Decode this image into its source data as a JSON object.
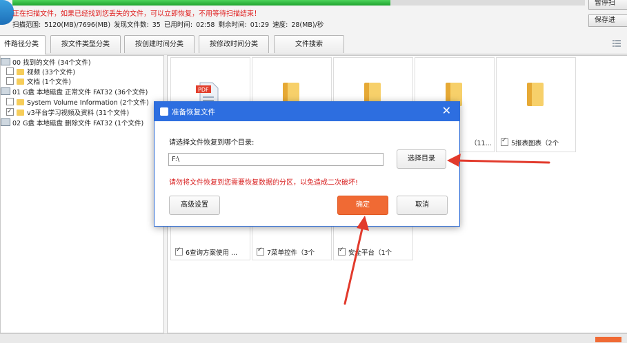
{
  "app": {
    "scan_warning": "正在扫描文件，如果已经找到您丢失的文件，可以立即恢复，不用等待扫描结束！",
    "stats": "扫描范围: 5120(MB)/7696(MB)   发现文件数: 35   已用时间: 02:58   剩余时间: 01:29   速度: 28(MB)/秒",
    "progress": 0.66,
    "buttons": {
      "pause": "暂停扫",
      "save": "保存进"
    }
  },
  "tabs": [
    {
      "label": "件路径分类",
      "active": true
    },
    {
      "label": "按文件类型分类",
      "active": false
    },
    {
      "label": "按创建时间分类",
      "active": false
    },
    {
      "label": "按修改时间分类",
      "active": false
    },
    {
      "label": "文件搜索",
      "active": false
    }
  ],
  "tree": [
    {
      "label": "00 找到的文件 (34个文件)"
    },
    {
      "label": "视频    (33个文件)"
    },
    {
      "label": "文档    (1个文件)"
    },
    {
      "label": "01 G盘 本地磁盘 正常文件 FAT32  (36个文件)"
    },
    {
      "label": "System Volume Information     (2个文件)"
    },
    {
      "label": "v3平台学习视频及资料     (31个文件)"
    },
    {
      "label": "02 G盘 本地磁盘 删除文件 FAT32  (1个文件)"
    }
  ],
  "grid": {
    "pdf_badge": "PDF",
    "cards_top": [
      {
        "label": ""
      },
      {
        "label": ""
      },
      {
        "label": ""
      },
      {
        "label": "（11..."
      },
      {
        "label": "5报表图表（2个"
      }
    ],
    "cards_bottom": [
      {
        "label": "6查询方案使用 ..."
      },
      {
        "label": "7菜单控件（3个"
      },
      {
        "label": "安全平台（1个"
      }
    ]
  },
  "dialog": {
    "title": "准备恢复文件",
    "close": "✕",
    "prompt": "请选择文件恢复到哪个目录:",
    "path_value": "F:\\",
    "choose_button": "选择目录",
    "warning": "请勿将文件恢复到您需要恢复数据的分区，以免造成二次破坏!",
    "advanced_button": "高级设置",
    "confirm_button": "确定",
    "cancel_button": "取消"
  },
  "colors": {
    "accent_blue": "#2d6ee0",
    "confirm_orange": "#f06a34",
    "warning_red": "#d81e1e",
    "progress_green": "#2bb53a",
    "arrow_red": "#e23a2c"
  }
}
